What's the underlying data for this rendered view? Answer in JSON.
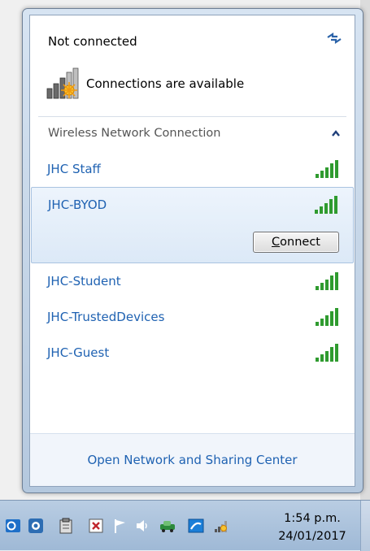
{
  "flyout": {
    "status_title": "Not connected",
    "status_message": "Connections are available",
    "section_label": "Wireless Network Connection",
    "networks": [
      {
        "name": "JHC Staff",
        "selected": false
      },
      {
        "name": "JHC-BYOD",
        "selected": true
      },
      {
        "name": "JHC-Student",
        "selected": false
      },
      {
        "name": "JHC-TrustedDevices",
        "selected": false
      },
      {
        "name": "JHC-Guest",
        "selected": false
      }
    ],
    "connect_button": {
      "accel": "C",
      "rest": "onnect"
    },
    "footer_link": "Open Network and Sharing Center"
  },
  "taskbar": {
    "tray_icons": [
      "outlook-icon",
      "photo-icon",
      "clipboard-icon",
      "close-icon",
      "flag-icon",
      "speaker-icon",
      "car-icon",
      "network-share-icon",
      "network-warning-icon"
    ],
    "time": "1:54 p.m.",
    "date": "24/01/2017"
  },
  "colors": {
    "link": "#1f62b2",
    "signal_green": "#2f9b2f",
    "warning_orange": "#f0a020"
  }
}
